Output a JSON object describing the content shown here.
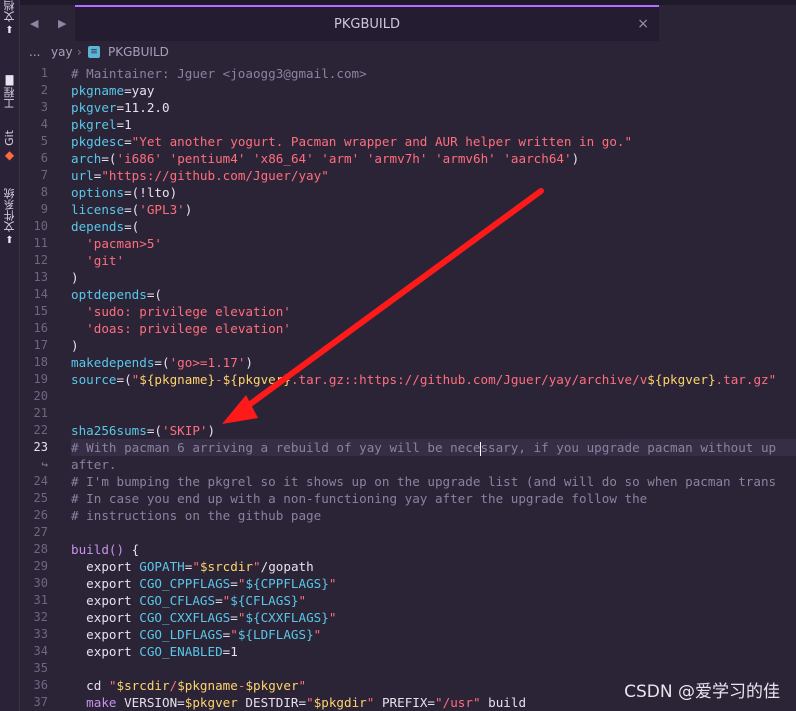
{
  "sidebar": {
    "items": [
      {
        "label": "文档"
      },
      {
        "label": "工程"
      },
      {
        "label": "Git"
      },
      {
        "label": "文件系统"
      }
    ]
  },
  "tab": {
    "title": "PKGBUILD",
    "close": "×"
  },
  "nav": {
    "back": "◀",
    "forward": "▶"
  },
  "breadcrumb": {
    "ellipsis": "...",
    "folder": "yay",
    "separator": "›",
    "file": "PKGBUILD"
  },
  "editor": {
    "active_line": "23",
    "wrap_marker": "↪",
    "lines": [
      {
        "n": "1",
        "segs": [
          {
            "t": "# Maintainer: Jguer <joaogg3@gmail.com>",
            "k": "comment"
          }
        ]
      },
      {
        "n": "2",
        "segs": [
          {
            "t": "pkgname",
            "k": "var"
          },
          {
            "t": "=yay",
            "k": "plain"
          }
        ]
      },
      {
        "n": "3",
        "segs": [
          {
            "t": "pkgver",
            "k": "var"
          },
          {
            "t": "=11.2.0",
            "k": "plain"
          }
        ]
      },
      {
        "n": "4",
        "segs": [
          {
            "t": "pkgrel",
            "k": "var"
          },
          {
            "t": "=1",
            "k": "plain"
          }
        ]
      },
      {
        "n": "5",
        "segs": [
          {
            "t": "pkgdesc",
            "k": "var"
          },
          {
            "t": "=",
            "k": "plain"
          },
          {
            "t": "\"Yet another yogurt. Pacman wrapper and AUR helper written in go.\"",
            "k": "str"
          }
        ]
      },
      {
        "n": "6",
        "segs": [
          {
            "t": "arch",
            "k": "var"
          },
          {
            "t": "=(",
            "k": "plain"
          },
          {
            "t": "'i686'",
            "k": "str"
          },
          {
            "t": " ",
            "k": "plain"
          },
          {
            "t": "'pentium4'",
            "k": "str"
          },
          {
            "t": " ",
            "k": "plain"
          },
          {
            "t": "'x86_64'",
            "k": "str"
          },
          {
            "t": " ",
            "k": "plain"
          },
          {
            "t": "'arm'",
            "k": "str"
          },
          {
            "t": " ",
            "k": "plain"
          },
          {
            "t": "'armv7h'",
            "k": "str"
          },
          {
            "t": " ",
            "k": "plain"
          },
          {
            "t": "'armv6h'",
            "k": "str"
          },
          {
            "t": " ",
            "k": "plain"
          },
          {
            "t": "'aarch64'",
            "k": "str"
          },
          {
            "t": ")",
            "k": "plain"
          }
        ]
      },
      {
        "n": "7",
        "segs": [
          {
            "t": "url",
            "k": "var"
          },
          {
            "t": "=",
            "k": "plain"
          },
          {
            "t": "\"https://github.com/Jguer/yay\"",
            "k": "str"
          }
        ]
      },
      {
        "n": "8",
        "segs": [
          {
            "t": "options",
            "k": "var"
          },
          {
            "t": "=(!lto)",
            "k": "plain"
          }
        ]
      },
      {
        "n": "9",
        "segs": [
          {
            "t": "license",
            "k": "var"
          },
          {
            "t": "=(",
            "k": "plain"
          },
          {
            "t": "'GPL3'",
            "k": "str"
          },
          {
            "t": ")",
            "k": "plain"
          }
        ]
      },
      {
        "n": "10",
        "segs": [
          {
            "t": "depends",
            "k": "var"
          },
          {
            "t": "=(",
            "k": "plain"
          }
        ]
      },
      {
        "n": "11",
        "segs": [
          {
            "t": "  ",
            "k": "plain"
          },
          {
            "t": "'pacman>5'",
            "k": "str"
          }
        ]
      },
      {
        "n": "12",
        "segs": [
          {
            "t": "  ",
            "k": "plain"
          },
          {
            "t": "'git'",
            "k": "str"
          }
        ]
      },
      {
        "n": "13",
        "segs": [
          {
            "t": ")",
            "k": "plain"
          }
        ]
      },
      {
        "n": "14",
        "segs": [
          {
            "t": "optdepends",
            "k": "var"
          },
          {
            "t": "=(",
            "k": "plain"
          }
        ]
      },
      {
        "n": "15",
        "segs": [
          {
            "t": "  ",
            "k": "plain"
          },
          {
            "t": "'sudo: privilege elevation'",
            "k": "str"
          }
        ]
      },
      {
        "n": "16",
        "segs": [
          {
            "t": "  ",
            "k": "plain"
          },
          {
            "t": "'doas: privilege elevation'",
            "k": "str"
          }
        ]
      },
      {
        "n": "17",
        "segs": [
          {
            "t": ")",
            "k": "plain"
          }
        ]
      },
      {
        "n": "18",
        "segs": [
          {
            "t": "makedepends",
            "k": "var"
          },
          {
            "t": "=(",
            "k": "plain"
          },
          {
            "t": "'go>=1.17'",
            "k": "str"
          },
          {
            "t": ")",
            "k": "plain"
          }
        ]
      },
      {
        "n": "19",
        "segs": [
          {
            "t": "source",
            "k": "var"
          },
          {
            "t": "=(",
            "k": "plain"
          },
          {
            "t": "\"",
            "k": "str"
          },
          {
            "t": "${pkgname}",
            "k": "sub"
          },
          {
            "t": "-",
            "k": "str"
          },
          {
            "t": "${pkgver}",
            "k": "sub"
          },
          {
            "t": ".tar.gz::https://github.com/Jguer/yay/archive/v",
            "k": "str"
          },
          {
            "t": "${pkgver}",
            "k": "sub"
          },
          {
            "t": ".tar.gz\"",
            "k": "str"
          }
        ]
      },
      {
        "n": "20",
        "segs": []
      },
      {
        "n": "21",
        "segs": []
      },
      {
        "n": "22",
        "segs": [
          {
            "t": "sha256sums",
            "k": "var"
          },
          {
            "t": "=(",
            "k": "plain"
          },
          {
            "t": "'SKIP'",
            "k": "str"
          },
          {
            "t": ")",
            "k": "plain"
          }
        ]
      },
      {
        "n": "23",
        "cur": true,
        "segs": [
          {
            "t": "# With pacman 6 arriving a rebuild of yay will be nece",
            "k": "comment"
          },
          {
            "t": "|",
            "k": "cursor"
          },
          {
            "t": "ssary, if you upgrade pacman without up",
            "k": "comment"
          }
        ]
      },
      {
        "n": "↪",
        "wrap": true,
        "segs": [
          {
            "t": "after.",
            "k": "comment"
          }
        ]
      },
      {
        "n": "24",
        "segs": [
          {
            "t": "# I'm bumping the pkgrel so it shows up on the upgrade list (and will do so when pacman trans",
            "k": "comment"
          }
        ]
      },
      {
        "n": "25",
        "segs": [
          {
            "t": "# In case you end up with a non-functioning yay after the upgrade follow the",
            "k": "comment"
          }
        ]
      },
      {
        "n": "26",
        "segs": [
          {
            "t": "# instructions on the github page",
            "k": "comment"
          }
        ]
      },
      {
        "n": "27",
        "segs": []
      },
      {
        "n": "28",
        "segs": [
          {
            "t": "build",
            "k": "kw"
          },
          {
            "t": "() ",
            "k": "kw"
          },
          {
            "t": "{",
            "k": "plain"
          }
        ]
      },
      {
        "n": "29",
        "segs": [
          {
            "t": "  export ",
            "k": "plain"
          },
          {
            "t": "GOPATH",
            "k": "var"
          },
          {
            "t": "=",
            "k": "plain"
          },
          {
            "t": "\"",
            "k": "str"
          },
          {
            "t": "$srcdir",
            "k": "sub"
          },
          {
            "t": "\"",
            "k": "str"
          },
          {
            "t": "/gopath",
            "k": "plain"
          }
        ]
      },
      {
        "n": "30",
        "segs": [
          {
            "t": "  export ",
            "k": "plain"
          },
          {
            "t": "CGO_CPPFLAGS",
            "k": "var"
          },
          {
            "t": "=",
            "k": "plain"
          },
          {
            "t": "\"",
            "k": "str"
          },
          {
            "t": "${CPPFLAGS}",
            "k": "var"
          },
          {
            "t": "\"",
            "k": "str"
          }
        ]
      },
      {
        "n": "31",
        "segs": [
          {
            "t": "  export ",
            "k": "plain"
          },
          {
            "t": "CGO_CFLAGS",
            "k": "var"
          },
          {
            "t": "=",
            "k": "plain"
          },
          {
            "t": "\"",
            "k": "str"
          },
          {
            "t": "${CFLAGS}",
            "k": "var"
          },
          {
            "t": "\"",
            "k": "str"
          }
        ]
      },
      {
        "n": "32",
        "segs": [
          {
            "t": "  export ",
            "k": "plain"
          },
          {
            "t": "CGO_CXXFLAGS",
            "k": "var"
          },
          {
            "t": "=",
            "k": "plain"
          },
          {
            "t": "\"",
            "k": "str"
          },
          {
            "t": "${CXXFLAGS}",
            "k": "var"
          },
          {
            "t": "\"",
            "k": "str"
          }
        ]
      },
      {
        "n": "33",
        "segs": [
          {
            "t": "  export ",
            "k": "plain"
          },
          {
            "t": "CGO_LDFLAGS",
            "k": "var"
          },
          {
            "t": "=",
            "k": "plain"
          },
          {
            "t": "\"",
            "k": "str"
          },
          {
            "t": "${LDFLAGS}",
            "k": "var"
          },
          {
            "t": "\"",
            "k": "str"
          }
        ]
      },
      {
        "n": "34",
        "segs": [
          {
            "t": "  export ",
            "k": "plain"
          },
          {
            "t": "CGO_ENABLED",
            "k": "var"
          },
          {
            "t": "=1",
            "k": "plain"
          }
        ]
      },
      {
        "n": "35",
        "segs": []
      },
      {
        "n": "36",
        "segs": [
          {
            "t": "  cd ",
            "k": "plain"
          },
          {
            "t": "\"",
            "k": "str"
          },
          {
            "t": "$srcdir",
            "k": "sub"
          },
          {
            "t": "/",
            "k": "str"
          },
          {
            "t": "$pkgname",
            "k": "sub"
          },
          {
            "t": "-",
            "k": "str"
          },
          {
            "t": "$pkgver",
            "k": "sub"
          },
          {
            "t": "\"",
            "k": "str"
          }
        ]
      },
      {
        "n": "37",
        "segs": [
          {
            "t": "  ",
            "k": "plain"
          },
          {
            "t": "make",
            "k": "kw"
          },
          {
            "t": " VERSION=",
            "k": "plain"
          },
          {
            "t": "$pkgver",
            "k": "sub"
          },
          {
            "t": " DESTDIR=",
            "k": "plain"
          },
          {
            "t": "\"",
            "k": "str"
          },
          {
            "t": "$pkgdir",
            "k": "sub"
          },
          {
            "t": "\"",
            "k": "str"
          },
          {
            "t": " PREFIX=",
            "k": "plain"
          },
          {
            "t": "\"/usr\"",
            "k": "str"
          },
          {
            "t": " build",
            "k": "plain"
          }
        ]
      }
    ]
  },
  "watermark": "CSDN @爱学习的佳",
  "colors": {
    "accent": "#b56cff",
    "arrow": "#ff1a1a",
    "background": "#2b2437"
  }
}
